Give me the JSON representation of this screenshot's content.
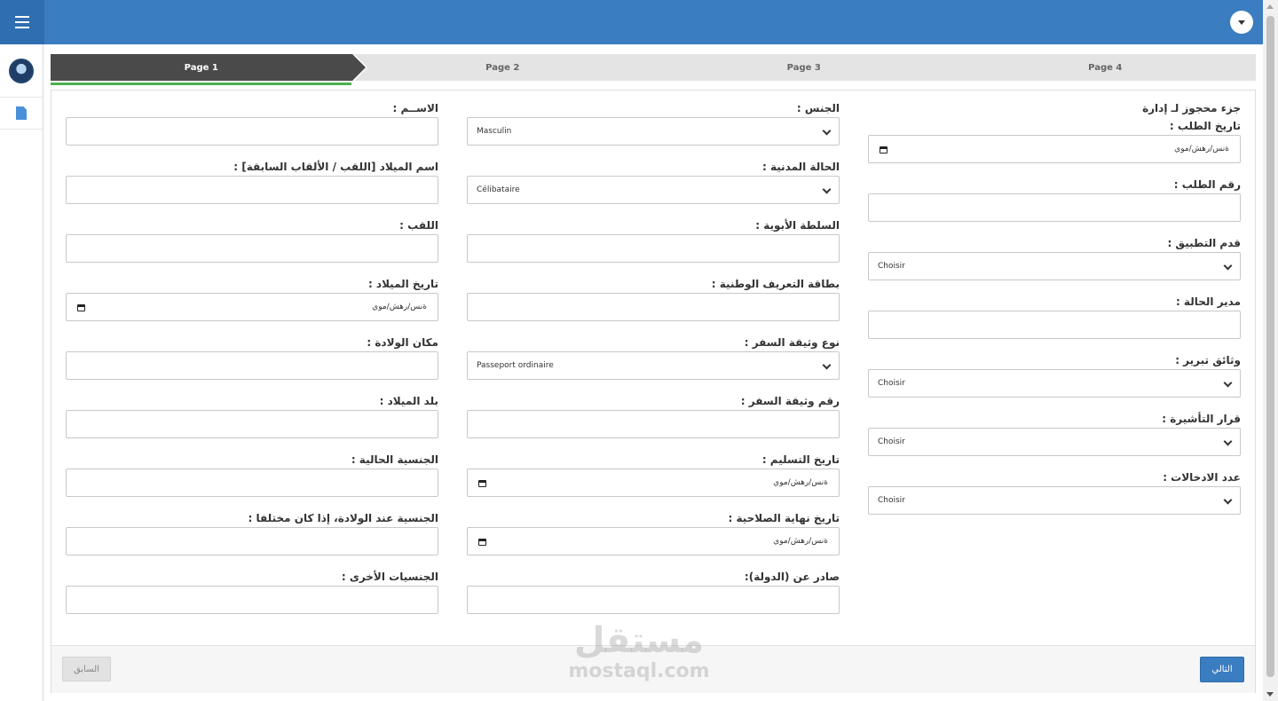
{
  "steps": [
    "Page 1",
    "Page 2",
    "Page 3",
    "Page 4"
  ],
  "admin_section": {
    "heading": "جزء محجوز لـ إدارة",
    "request_date_label": "تاريخ الطلب :",
    "date_placeholder": "ةنس/رهش/موي",
    "request_number_label": "رقم الطلب :",
    "app_progress_label": "قدم التطبيق :",
    "app_progress_value": "Choisir",
    "case_manager_label": "مدير الحالة :",
    "justification_docs_label": "وثائق تبرير :",
    "justification_docs_value": "Choisir",
    "visa_decision_label": "قرار التأشيرة :",
    "visa_decision_value": "Choisir",
    "entries_label": "عدد الادخالات :",
    "entries_value": "Choisir"
  },
  "middle": {
    "gender_label": "الجنس :",
    "gender_value": "Masculin",
    "civil_status_label": "الحالة المدنية :",
    "civil_status_value": "Célibataire",
    "parental_authority_label": "السلطة الأبوية :",
    "national_id_label": "بطاقة التعريف الوطنية :",
    "travel_doc_type_label": "نوع وثيقة السفر :",
    "travel_doc_type_value": "Passeport ordinaire",
    "travel_doc_number_label": "رقم وثيقة السفر :",
    "issue_date_label": "تاريخ التسليم :",
    "expiry_date_label": "تاريخ نهاية الصلاحية :",
    "issued_by_label": "صادر عن (الدولة):"
  },
  "left": {
    "name_label": "الاســم :",
    "birth_name_label": "اسم الميلاد [اللقب / الألقاب السابقة] :",
    "surname_label": "اللقب :",
    "birth_date_label": "تاريخ الميلاد :",
    "birth_place_label": "مكان الولادة :",
    "birth_country_label": "بلد الميلاد :",
    "current_nationality_label": "الجنسية الحالية :",
    "birth_nationality_label": "الجنسية عند الولادة، إذا كان مختلفا :",
    "other_nationalities_label": "الجنسيات الأخرى :"
  },
  "footer": {
    "prev_label": "السابق",
    "next_label": "التالي"
  },
  "watermark": {
    "brand_ar": "مستقل",
    "brand_url": "mostaql.com"
  }
}
